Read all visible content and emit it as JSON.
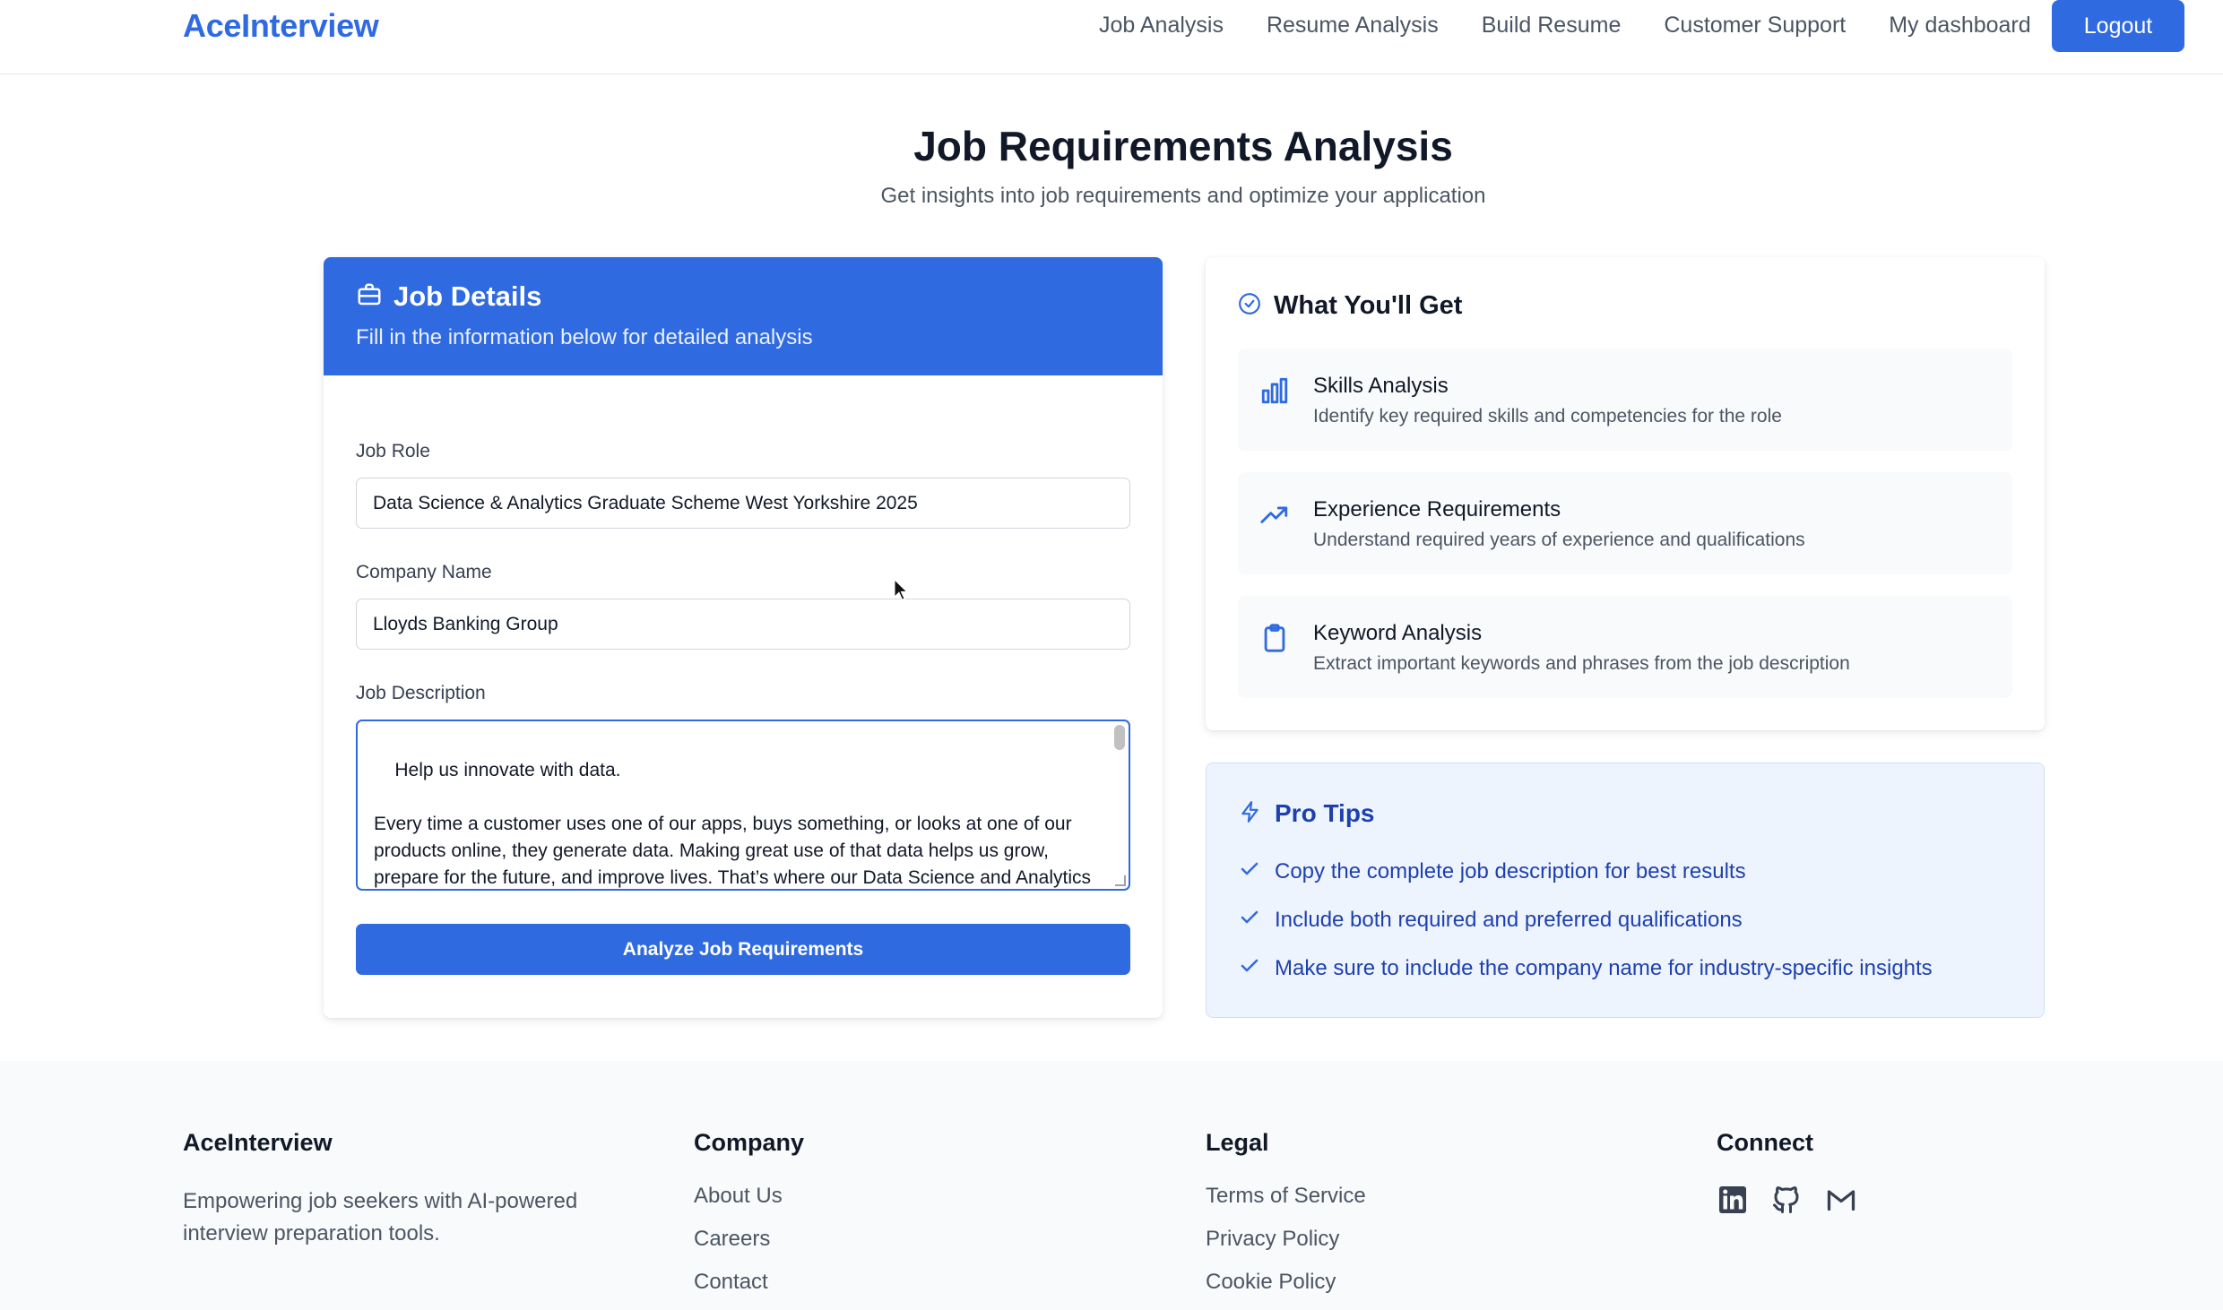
{
  "header": {
    "brand": "AceInterview",
    "nav": [
      "Job Analysis",
      "Resume Analysis",
      "Build Resume",
      "Customer Support",
      "My dashboard"
    ],
    "logout_label": "Logout"
  },
  "page": {
    "title": "Job Requirements Analysis",
    "subtitle": "Get insights into job requirements and optimize your application"
  },
  "job_details": {
    "title": "Job Details",
    "description": "Fill in the information below for detailed analysis",
    "job_role_label": "Job Role",
    "job_role_value": "Data Science & Analytics Graduate Scheme West Yorkshire 2025",
    "company_label": "Company Name",
    "company_value": "Lloyds Banking Group",
    "description_label": "Job Description",
    "description_value": "Help us innovate with data.\n\nEvery time a customer uses one of our apps, buys something, or looks at one of our products online, they generate data. Making great use of that data helps us grow, prepare for the future, and improve lives. That’s where our Data Science and Analytics teams come in.",
    "analyze_label": "Analyze Job Requirements"
  },
  "what_you_get": {
    "title": "What You'll Get",
    "features": [
      {
        "title": "Skills Analysis",
        "desc": "Identify key required skills and competencies for the role",
        "icon": "bar-chart-icon"
      },
      {
        "title": "Experience Requirements",
        "desc": "Understand required years of experience and qualifications",
        "icon": "trending-up-icon"
      },
      {
        "title": "Keyword Analysis",
        "desc": "Extract important keywords and phrases from the job description",
        "icon": "clipboard-icon"
      }
    ]
  },
  "pro_tips": {
    "title": "Pro Tips",
    "tips": [
      "Copy the complete job description for best results",
      "Include both required and preferred qualifications",
      "Make sure to include the company name for industry-specific insights"
    ]
  },
  "footer": {
    "brand": "AceInterview",
    "tagline": "Empowering job seekers with AI-powered interview preparation tools.",
    "company_title": "Company",
    "company_links": [
      "About Us",
      "Careers",
      "Contact"
    ],
    "legal_title": "Legal",
    "legal_links": [
      "Terms of Service",
      "Privacy Policy",
      "Cookie Policy"
    ],
    "connect_title": "Connect",
    "social_icons": [
      "linkedin-icon",
      "github-icon",
      "gmail-icon"
    ]
  },
  "colors": {
    "accent": "#2f6ae0",
    "tips_text": "#1e40af",
    "tips_bg": "#eef4fe"
  }
}
